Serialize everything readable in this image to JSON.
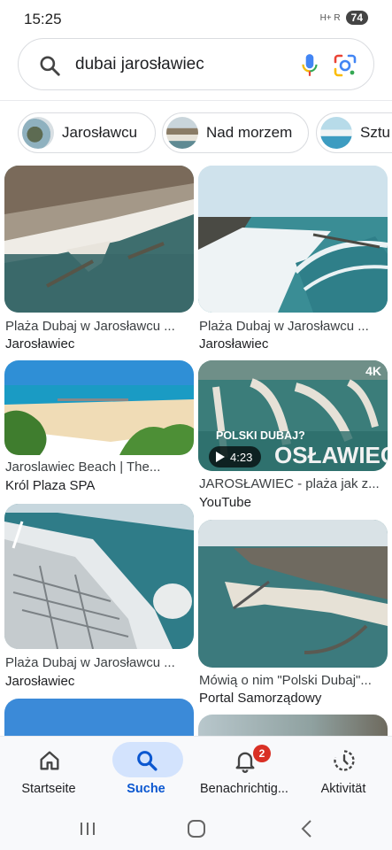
{
  "status_bar": {
    "time": "15:25",
    "signal_text": "H+ R",
    "battery": "74"
  },
  "search": {
    "query": "dubai jarosławiec"
  },
  "chips": [
    {
      "label": "Jarosławcu"
    },
    {
      "label": "Nad morzem"
    },
    {
      "label": "Sztu"
    }
  ],
  "results": [
    {
      "title": "Plaża Dubaj w Jarosławcu ...",
      "source": "Jarosławiec"
    },
    {
      "title": "Plaża Dubaj w Jarosławcu ...",
      "source": "Jarosławiec"
    },
    {
      "title": "Jaroslawiec Beach | The...",
      "source": "Król Plaza SPA"
    },
    {
      "title": "JAROSŁAWIEC - plaża jak z...",
      "source": "YouTube",
      "video_duration": "4:23",
      "overlay_top": "4K",
      "overlay_text_1": "POLSKI DUBAJ?",
      "overlay_text_2": "OSŁAWIEC"
    },
    {
      "title": "Plaża Dubaj w Jarosławcu ...",
      "source": "Jarosławiec"
    },
    {
      "title": "Mówią o nim \"Polski Dubaj\"...",
      "source": "Portal Samorządowy"
    }
  ],
  "bottom_nav": [
    {
      "label": "Startseite",
      "icon": "home-icon"
    },
    {
      "label": "Suche",
      "icon": "search-icon",
      "active": true
    },
    {
      "label": "Benachrichtig...",
      "icon": "bell-icon",
      "badge": "2"
    },
    {
      "label": "Aktivität",
      "icon": "activity-icon"
    }
  ],
  "colors": {
    "accent": "#0b57d0",
    "pill": "#d3e3fd",
    "badge": "#d93025"
  }
}
